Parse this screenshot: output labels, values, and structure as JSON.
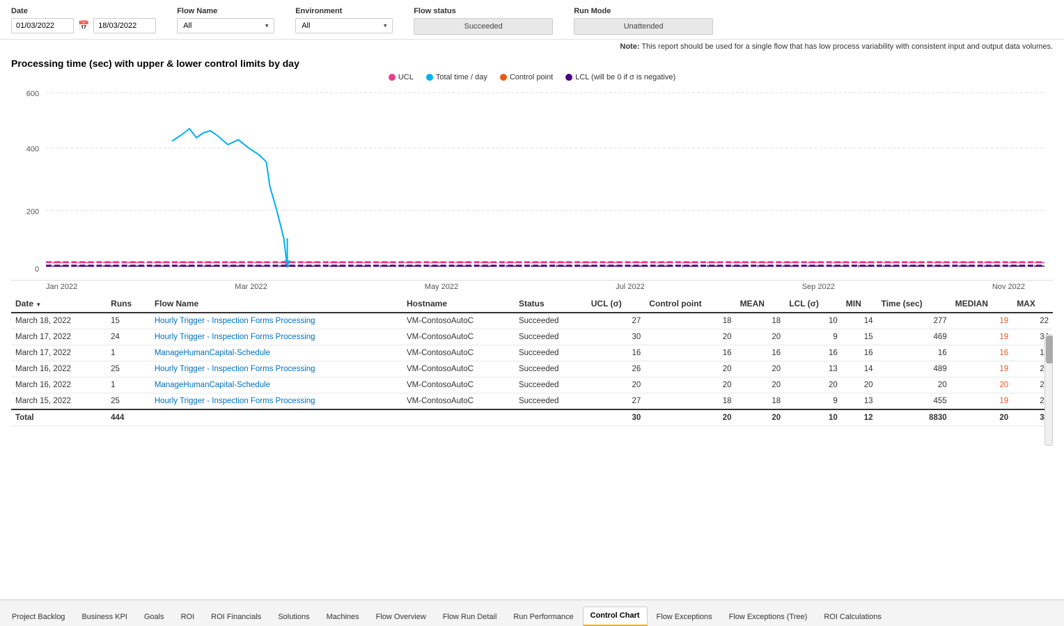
{
  "filters": {
    "date_label": "Date",
    "date_start": "01/03/2022",
    "date_end": "18/03/2022",
    "flow_name_label": "Flow Name",
    "flow_name_value": "All",
    "environment_label": "Environment",
    "environment_value": "All",
    "flow_status_label": "Flow status",
    "flow_status_value": "Succeeded",
    "run_mode_label": "Run Mode",
    "run_mode_value": "Unattended"
  },
  "note": {
    "prefix": "Note:",
    "text": " This report should be used for a single flow that has low process variability with consistent input and output data volumes."
  },
  "chart": {
    "title": "Processing time (sec) with upper & lower control limits by day",
    "legend": [
      {
        "label": "UCL",
        "color": "#e83e8c",
        "id": "ucl"
      },
      {
        "label": "Total time / day",
        "color": "#00b0f0",
        "id": "total-time"
      },
      {
        "label": "Control point",
        "color": "#e85c1a",
        "id": "control-point"
      },
      {
        "label": "LCL (will be 0 if σ is negative)",
        "color": "#4b0082",
        "id": "lcl"
      }
    ],
    "y_labels": [
      "600",
      "400",
      "200",
      "0"
    ],
    "x_labels": [
      "Jan 2022",
      "Mar 2022",
      "May 2022",
      "Jul 2022",
      "Sep 2022",
      "Nov 2022"
    ]
  },
  "table": {
    "columns": [
      {
        "key": "date",
        "label": "Date"
      },
      {
        "key": "runs",
        "label": "Runs"
      },
      {
        "key": "flow_name",
        "label": "Flow Name"
      },
      {
        "key": "hostname",
        "label": "Hostname"
      },
      {
        "key": "status",
        "label": "Status"
      },
      {
        "key": "ucl",
        "label": "UCL (σ)"
      },
      {
        "key": "control_point",
        "label": "Control point"
      },
      {
        "key": "mean",
        "label": "MEAN"
      },
      {
        "key": "lcl",
        "label": "LCL (σ)"
      },
      {
        "key": "min",
        "label": "MIN"
      },
      {
        "key": "time_sec",
        "label": "Time (sec)"
      },
      {
        "key": "median",
        "label": "MEDIAN"
      },
      {
        "key": "max",
        "label": "MAX"
      }
    ],
    "rows": [
      {
        "date": "March 18, 2022",
        "runs": "15",
        "flow_name": "Hourly Trigger - Inspection Forms Processing",
        "hostname": "VM-ContosoAutoC",
        "status": "Succeeded",
        "ucl": "27",
        "control_point": "18",
        "mean": "18",
        "lcl": "10",
        "min": "14",
        "time_sec": "277",
        "median": "19",
        "max": "22"
      },
      {
        "date": "March 17, 2022",
        "runs": "24",
        "flow_name": "Hourly Trigger - Inspection Forms Processing",
        "hostname": "VM-ContosoAutoC",
        "status": "Succeeded",
        "ucl": "30",
        "control_point": "20",
        "mean": "20",
        "lcl": "9",
        "min": "15",
        "time_sec": "469",
        "median": "19",
        "max": "34"
      },
      {
        "date": "March 17, 2022",
        "runs": "1",
        "flow_name": "ManageHumanCapital-Schedule",
        "hostname": "VM-ContosoAutoC",
        "status": "Succeeded",
        "ucl": "16",
        "control_point": "16",
        "mean": "16",
        "lcl": "16",
        "min": "16",
        "time_sec": "16",
        "median": "16",
        "max": "16"
      },
      {
        "date": "March 16, 2022",
        "runs": "25",
        "flow_name": "Hourly Trigger - Inspection Forms Processing",
        "hostname": "VM-ContosoAutoC",
        "status": "Succeeded",
        "ucl": "26",
        "control_point": "20",
        "mean": "20",
        "lcl": "13",
        "min": "14",
        "time_sec": "489",
        "median": "19",
        "max": "24"
      },
      {
        "date": "March 16, 2022",
        "runs": "1",
        "flow_name": "ManageHumanCapital-Schedule",
        "hostname": "VM-ContosoAutoC",
        "status": "Succeeded",
        "ucl": "20",
        "control_point": "20",
        "mean": "20",
        "lcl": "20",
        "min": "20",
        "time_sec": "20",
        "median": "20",
        "max": "20"
      },
      {
        "date": "March 15, 2022",
        "runs": "25",
        "flow_name": "Hourly Trigger - Inspection Forms Processing",
        "hostname": "VM-ContosoAutoC",
        "status": "Succeeded",
        "ucl": "27",
        "control_point": "18",
        "mean": "18",
        "lcl": "9",
        "min": "13",
        "time_sec": "455",
        "median": "19",
        "max": "24"
      }
    ],
    "total": {
      "label": "Total",
      "runs": "444",
      "ucl": "30",
      "control_point": "20",
      "mean": "20",
      "lcl": "10",
      "min": "12",
      "time_sec": "8830",
      "median": "20",
      "max": "34"
    }
  },
  "tabs": [
    {
      "label": "Project Backlog",
      "active": false
    },
    {
      "label": "Business KPI",
      "active": false
    },
    {
      "label": "Goals",
      "active": false
    },
    {
      "label": "ROI",
      "active": false
    },
    {
      "label": "ROI Financials",
      "active": false
    },
    {
      "label": "Solutions",
      "active": false
    },
    {
      "label": "Machines",
      "active": false
    },
    {
      "label": "Flow Overview",
      "active": false
    },
    {
      "label": "Flow Run Detail",
      "active": false
    },
    {
      "label": "Run Performance",
      "active": false
    },
    {
      "label": "Control Chart",
      "active": true
    },
    {
      "label": "Flow Exceptions",
      "active": false
    },
    {
      "label": "Flow Exceptions (Tree)",
      "active": false
    },
    {
      "label": "ROI Calculations",
      "active": false
    }
  ]
}
